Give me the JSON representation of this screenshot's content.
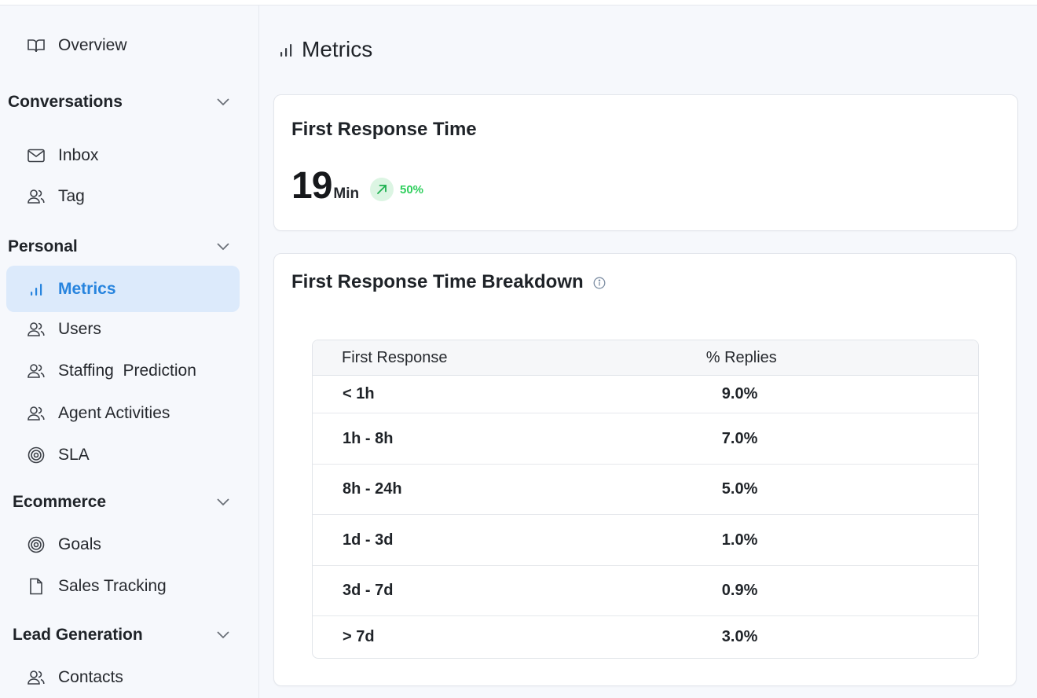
{
  "sidebar": {
    "overview": "Overview",
    "sections": [
      {
        "label": "Conversations",
        "items": [
          {
            "label": "Inbox",
            "icon": "mail-icon"
          },
          {
            "label": "Tag",
            "icon": "users-icon"
          }
        ]
      },
      {
        "label": "Personal",
        "items": [
          {
            "label": "Metrics",
            "icon": "bar-chart-icon",
            "active": true
          },
          {
            "label": "Users",
            "icon": "users-icon"
          },
          {
            "label": "Staffing  Prediction",
            "icon": "users-icon"
          },
          {
            "label": "Agent Activities",
            "icon": "users-icon"
          },
          {
            "label": "SLA",
            "icon": "target-icon"
          }
        ]
      },
      {
        "label": "Ecommerce",
        "items": [
          {
            "label": "Goals",
            "icon": "target-icon"
          },
          {
            "label": "Sales Tracking",
            "icon": "file-icon"
          }
        ]
      },
      {
        "label": "Lead Generation",
        "items": [
          {
            "label": "Contacts",
            "icon": "users-icon"
          }
        ]
      }
    ]
  },
  "header": {
    "title": "Metrics"
  },
  "frt_card": {
    "title": "First Response Time",
    "value": "19",
    "unit": "Min",
    "trend": "50%",
    "trend_direction": "up",
    "trend_color": "#2fcf5d"
  },
  "breakdown_card": {
    "title": "First Response Time Breakdown",
    "table": {
      "headers": [
        "First Response",
        "% Replies"
      ],
      "rows": [
        [
          "< 1h",
          "9.0%"
        ],
        [
          "1h - 8h",
          "7.0%"
        ],
        [
          "8h - 24h",
          "5.0%"
        ],
        [
          "1d - 3d",
          "1.0%"
        ],
        [
          "3d - 7d",
          "0.9%"
        ],
        [
          "> 7d",
          "3.0%"
        ]
      ]
    }
  },
  "colors": {
    "accent": "#2784de",
    "active_bg": "#dceafb",
    "positive": "#2fcf5d"
  }
}
